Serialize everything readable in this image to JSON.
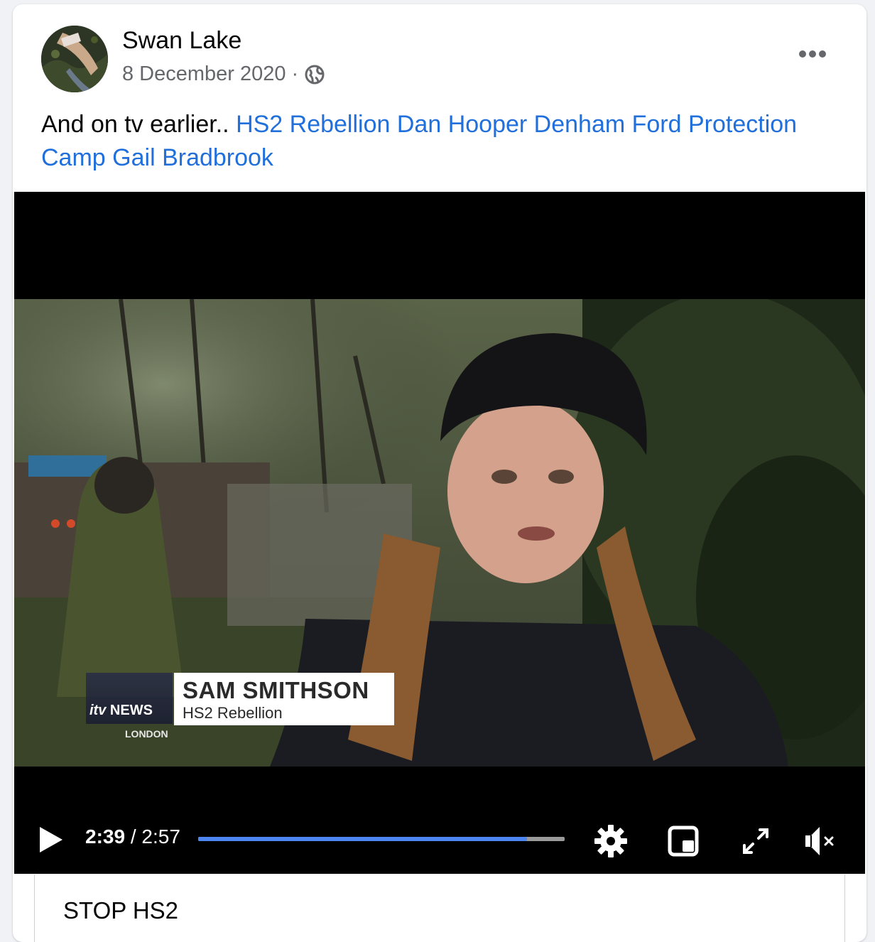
{
  "post": {
    "author": "Swan Lake",
    "date": "8 December 2020",
    "separator": "·",
    "privacy_icon": "globe-icon",
    "more_icon": "more-options-icon",
    "caption_text": "And on tv earlier..",
    "tags": [
      "HS2 Rebellion",
      "Dan Hooper",
      "Denham Ford Protection Camp",
      "Gail Bradbrook"
    ]
  },
  "video": {
    "current_time": "2:39",
    "time_separator": " / ",
    "duration": "2:57",
    "progress": 0.898,
    "lower_third": {
      "channel_logo": "itv",
      "channel_name": "NEWS",
      "region": "LONDON",
      "name": "SAM SMITHSON",
      "title": "HS2 Rebellion"
    },
    "controls": [
      "play-icon",
      "settings-icon",
      "picture-in-picture-icon",
      "fullscreen-icon",
      "muted-icon"
    ]
  },
  "link_card": {
    "title": "STOP HS2"
  },
  "colors": {
    "tag": "#216fdb",
    "progress": "#4d86f0",
    "meta": "#65676b"
  }
}
